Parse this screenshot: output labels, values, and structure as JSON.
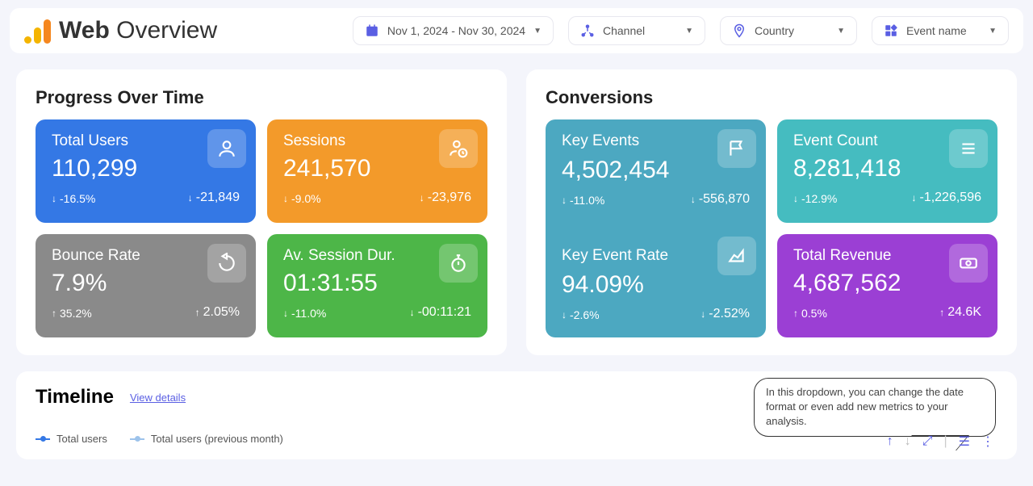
{
  "header": {
    "title_bold": "Web",
    "title_light": " Overview",
    "filters": {
      "date": "Nov 1, 2024 - Nov 30, 2024",
      "channel": "Channel",
      "country": "Country",
      "event": "Event name"
    }
  },
  "progress": {
    "title": "Progress Over Time",
    "cards": {
      "users": {
        "label": "Total Users",
        "value": "110,299",
        "pct": "-16.5%",
        "delta": "-21,849"
      },
      "sessions": {
        "label": "Sessions",
        "value": "241,570",
        "pct": "-9.0%",
        "delta": "-23,976"
      },
      "bounce": {
        "label": "Bounce Rate",
        "value": "7.9%",
        "pct": "35.2%",
        "delta": "2.05%"
      },
      "avgdur": {
        "label": "Av. Session Dur.",
        "value": "01:31:55",
        "pct": "-11.0%",
        "delta": "-00:11:21"
      }
    }
  },
  "conversions": {
    "title": "Conversions",
    "cards": {
      "keyevents": {
        "label": "Key Events",
        "value": "4,502,454",
        "pct": "-11.0%",
        "delta": "-556,870"
      },
      "eventcount": {
        "label": "Event Count",
        "value": "8,281,418",
        "pct": "-12.9%",
        "delta": "-1,226,596"
      },
      "keyrate": {
        "label": "Key Event Rate",
        "value": "94.09%",
        "pct": "-2.6%",
        "delta": "-2.52%"
      },
      "revenue": {
        "label": "Total Revenue",
        "value": "4,687,562",
        "pct": "0.5%",
        "delta": "24.6K"
      }
    }
  },
  "timeline": {
    "title": "Timeline",
    "view_details": "View details",
    "legend": {
      "a": "Total users",
      "b": "Total users (previous month)"
    },
    "tooltip": "In this dropdown, you can change the date format or even add new metrics to your analysis."
  }
}
